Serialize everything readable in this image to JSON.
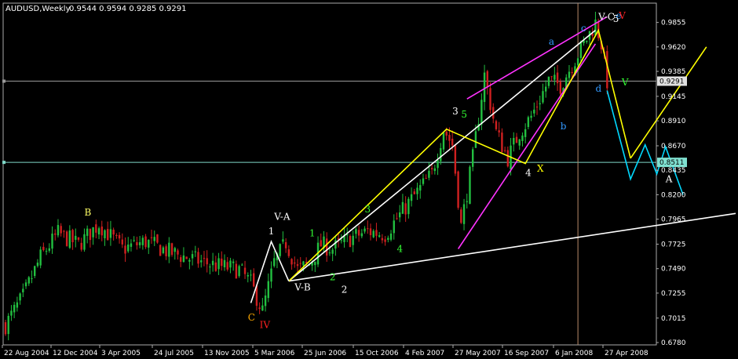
{
  "chart_data": {
    "type": "candlestick",
    "title": "AUDUSD,Weekly",
    "ohlc_header": "0.9544 0.9594 0.9285 0.9291",
    "ylim": [
      0.678,
      0.992
    ],
    "y_ticks": [
      "0.9855",
      "0.9620",
      "0.9385",
      "0.9145",
      "0.8910",
      "0.8670",
      "0.8435",
      "0.8200",
      "0.7965",
      "0.7725",
      "0.7490",
      "0.7255",
      "0.7015",
      "0.6780"
    ],
    "x_ticks": [
      "22 Aug 2004",
      "12 Dec 2004",
      "3 Apr 2005",
      "24 Jul 2005",
      "13 Nov 2005",
      "5 Mar 2006",
      "25 Jun 2006",
      "15 Oct 2006",
      "4 Feb 2007",
      "27 May 2007",
      "16 Sep 2007",
      "6 Jan 2008",
      "27 Apr 2008"
    ],
    "hlines": [
      {
        "price": 0.9291,
        "label": "0.9291",
        "color": "#9a9a9a",
        "box_fill": "#e0e0e0"
      },
      {
        "price": 0.8511,
        "label": "0.8511",
        "color": "#7fd8c8",
        "box_fill": "#7fe0d0"
      }
    ],
    "vline_date_index": 196,
    "candle_anchors": [
      [
        0,
        0.695
      ],
      [
        6,
        0.722
      ],
      [
        12,
        0.76
      ],
      [
        18,
        0.783
      ],
      [
        25,
        0.772
      ],
      [
        32,
        0.792
      ],
      [
        40,
        0.768
      ],
      [
        48,
        0.775
      ],
      [
        56,
        0.765
      ],
      [
        64,
        0.758
      ],
      [
        72,
        0.752
      ],
      [
        80,
        0.748
      ],
      [
        84,
        0.735
      ],
      [
        88,
        0.708
      ],
      [
        92,
        0.755
      ],
      [
        96,
        0.774
      ],
      [
        100,
        0.748
      ],
      [
        104,
        0.753
      ],
      [
        108,
        0.772
      ],
      [
        112,
        0.768
      ],
      [
        118,
        0.778
      ],
      [
        124,
        0.785
      ],
      [
        130,
        0.782
      ],
      [
        138,
        0.812
      ],
      [
        146,
        0.84
      ],
      [
        150,
        0.883
      ],
      [
        153,
        0.868
      ],
      [
        156,
        0.79
      ],
      [
        160,
        0.855
      ],
      [
        164,
        0.935
      ],
      [
        168,
        0.88
      ],
      [
        172,
        0.855
      ],
      [
        176,
        0.88
      ],
      [
        180,
        0.895
      ],
      [
        186,
        0.93
      ],
      [
        190,
        0.925
      ],
      [
        196,
        0.955
      ],
      [
        202,
        0.985
      ],
      [
        204,
        0.965
      ],
      [
        206,
        0.929
      ]
    ],
    "bull_color": "#22c040",
    "bear_color": "#d02020",
    "trendlines": [
      {
        "color": "#ffffff",
        "points": [
          [
            97,
            0.737
          ],
          [
            250,
            0.802
          ]
        ]
      },
      {
        "color": "#ffffff",
        "points": [
          [
            97,
            0.737
          ],
          [
            202,
            0.978
          ]
        ]
      },
      {
        "color": "#ff33ff",
        "points": [
          [
            155,
            0.768
          ],
          [
            202,
            0.965
          ]
        ]
      },
      {
        "color": "#ff33ff",
        "points": [
          [
            158,
            0.912
          ],
          [
            206,
            0.991
          ]
        ]
      },
      {
        "color": "#ffff00",
        "points": [
          [
            97,
            0.737
          ],
          [
            151,
            0.883
          ],
          [
            178,
            0.85
          ],
          [
            203,
            0.978
          ],
          [
            214,
            0.855
          ]
        ]
      },
      {
        "color": "#ffff00",
        "points": [
          [
            214,
            0.855
          ],
          [
            240,
            0.962
          ]
        ]
      },
      {
        "color": "#ffffff",
        "points": [
          [
            84,
            0.716
          ],
          [
            91,
            0.775
          ],
          [
            97,
            0.737
          ]
        ]
      },
      {
        "color": "#00d8ff",
        "points": [
          [
            206,
            0.92
          ],
          [
            214,
            0.835
          ],
          [
            219,
            0.868
          ],
          [
            223,
            0.84
          ],
          [
            226,
            0.866
          ],
          [
            232,
            0.82
          ]
        ]
      }
    ],
    "labels": [
      {
        "text": "B",
        "color": "#ffff66",
        "at": [
          27,
          0.8
        ]
      },
      {
        "text": "V-A",
        "color": "#ffffff",
        "at": [
          92,
          0.796
        ]
      },
      {
        "text": "1",
        "color": "#ffffff",
        "at": [
          90,
          0.782
        ]
      },
      {
        "text": "C",
        "color": "#ffaa00",
        "at": [
          83,
          0.699
        ]
      },
      {
        "text": "IV",
        "color": "#ff2020",
        "at": [
          87,
          0.692
        ]
      },
      {
        "text": "V-B",
        "color": "#ffffff",
        "at": [
          99,
          0.728
        ]
      },
      {
        "text": "2",
        "color": "#ffffff",
        "at": [
          115,
          0.726
        ]
      },
      {
        "text": "1",
        "color": "#33ff33",
        "at": [
          104,
          0.78
        ]
      },
      {
        "text": "2",
        "color": "#33ff33",
        "at": [
          111,
          0.738
        ]
      },
      {
        "text": "3",
        "color": "#33ff33",
        "at": [
          123,
          0.803
        ]
      },
      {
        "text": "4",
        "color": "#33ff33",
        "at": [
          134,
          0.765
        ]
      },
      {
        "text": "3",
        "color": "#ffffff",
        "at": [
          153,
          0.897
        ]
      },
      {
        "text": "5",
        "color": "#33ff33",
        "at": [
          156,
          0.894
        ]
      },
      {
        "text": "4",
        "color": "#ffffff",
        "at": [
          178,
          0.838
        ]
      },
      {
        "text": "X",
        "color": "#ffff00",
        "at": [
          182,
          0.842
        ]
      },
      {
        "text": "a",
        "color": "#3399ff",
        "at": [
          186,
          0.964
        ]
      },
      {
        "text": "b",
        "color": "#3399ff",
        "at": [
          190,
          0.883
        ]
      },
      {
        "text": "c",
        "color": "#3399ff",
        "at": [
          197,
          0.977
        ]
      },
      {
        "text": "d",
        "color": "#3399ff",
        "at": [
          202,
          0.919
        ]
      },
      {
        "text": "e",
        "color": "#3399ff",
        "at": [
          209,
          0.989
        ]
      },
      {
        "text": "V",
        "color": "#33ff33",
        "at": [
          211,
          0.925
        ]
      },
      {
        "text": "V-C",
        "color": "#ffffff",
        "at": [
          203,
          0.988
        ]
      },
      {
        "text": "5",
        "color": "#ffffff",
        "at": [
          208,
          0.986
        ]
      },
      {
        "text": "V",
        "color": "#ff2020",
        "at": [
          210,
          0.989
        ]
      },
      {
        "text": "A",
        "color": "#ffffff",
        "at": [
          226,
          0.832
        ]
      }
    ]
  }
}
